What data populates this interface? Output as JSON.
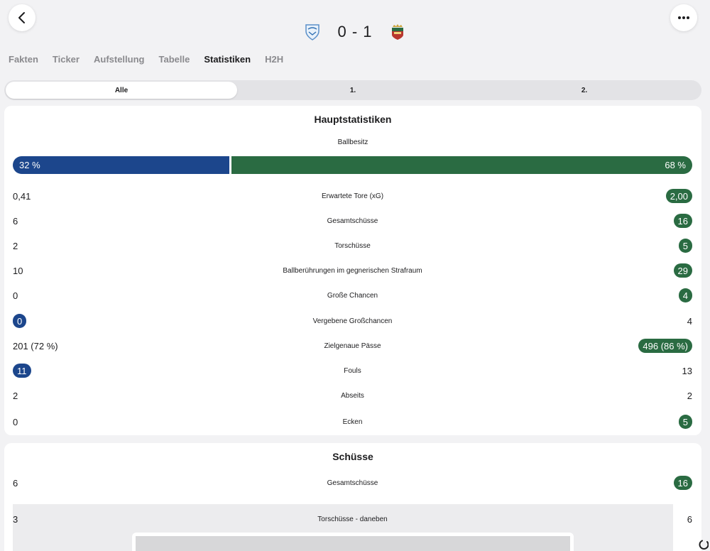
{
  "header": {
    "score": "0 - 1",
    "back_icon": "chevron-left-icon",
    "more_icon": "ellipsis-icon",
    "home_crest_icon": "home-team-crest-icon",
    "away_crest_icon": "away-team-crest-icon"
  },
  "tabs": [
    {
      "label": "Fakten",
      "active": false
    },
    {
      "label": "Ticker",
      "active": false
    },
    {
      "label": "Aufstellung",
      "active": false
    },
    {
      "label": "Tabelle",
      "active": false
    },
    {
      "label": "Statistiken",
      "active": true
    },
    {
      "label": "H2H",
      "active": false
    }
  ],
  "period_selector": [
    {
      "label": "Alle",
      "active": true
    },
    {
      "label": "1.",
      "active": false
    },
    {
      "label": "2.",
      "active": false
    }
  ],
  "colors": {
    "home": "#1c468c",
    "away": "#2a6b42",
    "background": "#f2f2f4",
    "card": "#ffffff"
  },
  "main_stats": {
    "title": "Hauptstatistiken",
    "possession": {
      "label": "Ballbesitz",
      "home": "32 %",
      "away": "68 %",
      "home_share": 0.32
    },
    "rows": [
      {
        "label": "Erwartete Tore (xG)",
        "home": "0,41",
        "away": "2,00",
        "highlight": "away"
      },
      {
        "label": "Gesamtschüsse",
        "home": "6",
        "away": "16",
        "highlight": "away"
      },
      {
        "label": "Torschüsse",
        "home": "2",
        "away": "5",
        "highlight": "away"
      },
      {
        "label": "Ballberührungen im gegnerischen Strafraum",
        "home": "10",
        "away": "29",
        "highlight": "away"
      },
      {
        "label": "Große Chancen",
        "home": "0",
        "away": "4",
        "highlight": "away"
      },
      {
        "label": "Vergebene Großchancen",
        "home": "0",
        "away": "4",
        "highlight": "home"
      },
      {
        "label": "Zielgenaue Pässe",
        "home": "201 (72 %)",
        "away": "496 (86 %)",
        "highlight": "away"
      },
      {
        "label": "Fouls",
        "home": "11",
        "away": "13",
        "highlight": "home"
      },
      {
        "label": "Abseits",
        "home": "2",
        "away": "2",
        "highlight": "none"
      },
      {
        "label": "Ecken",
        "home": "0",
        "away": "5",
        "highlight": "away"
      }
    ]
  },
  "shots": {
    "title": "Schüsse",
    "rows": [
      {
        "label": "Gesamtschüsse",
        "home": "6",
        "away": "16",
        "highlight": "away"
      },
      {
        "label": "Torschüsse - daneben",
        "home": "3",
        "away": "6",
        "highlight": "none"
      }
    ]
  }
}
